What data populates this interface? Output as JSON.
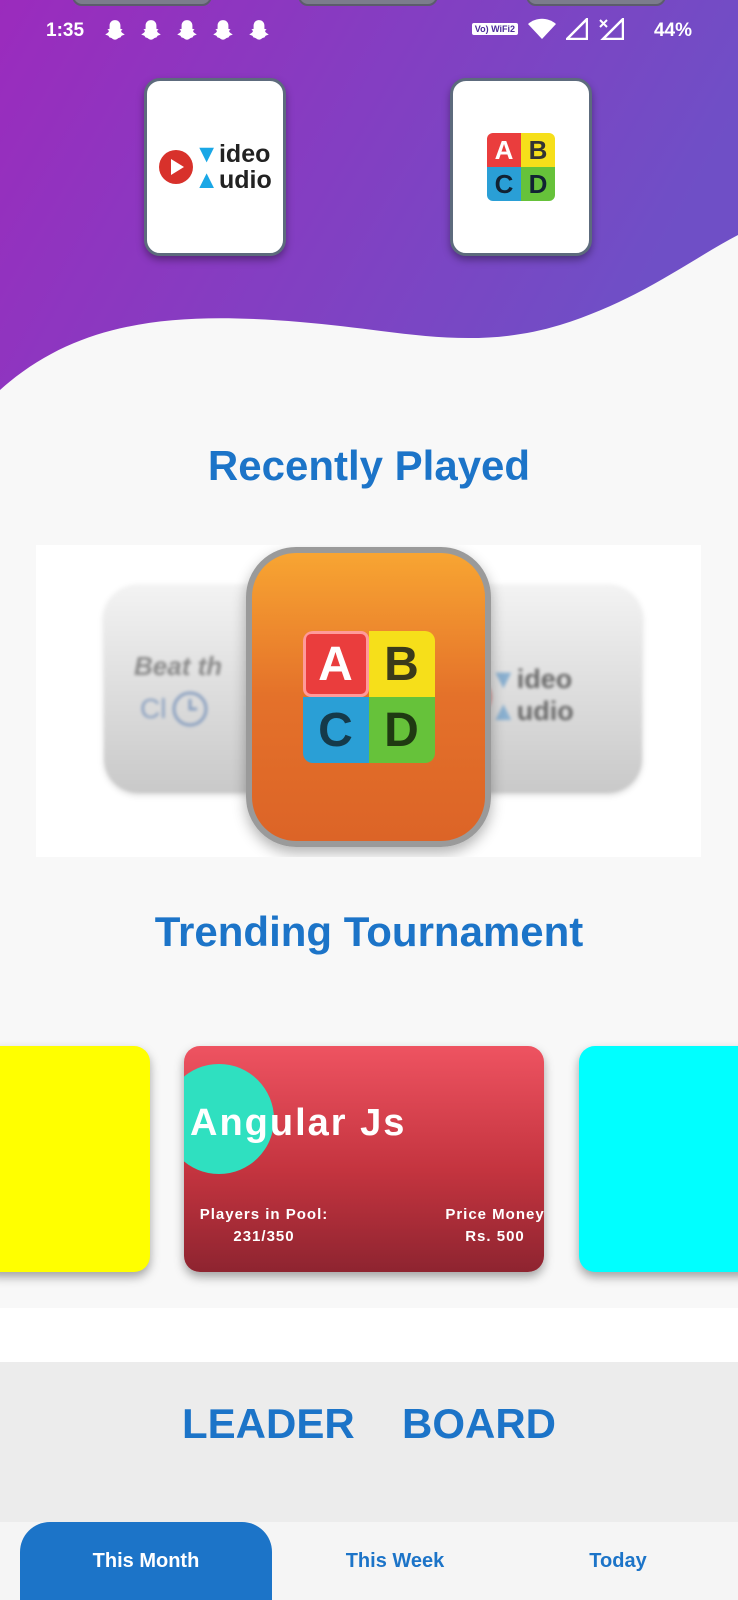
{
  "status_bar": {
    "time": "1:35",
    "network_label": "Vo) WiFi2",
    "battery": "44%"
  },
  "top_tiles": [
    {
      "name": "Video Audio",
      "line1": "ideo",
      "line2": "udio"
    },
    {
      "name": "ABCD",
      "letters": [
        "A",
        "B",
        "C",
        "D"
      ]
    }
  ],
  "recently_played": {
    "title": "Recently Played",
    "left_card": {
      "line1": "Beat th",
      "line2": "Cl"
    },
    "right_card": {
      "line1": "ideo",
      "line2": "udio"
    },
    "center_card": {
      "letters": [
        "A",
        "B",
        "C",
        "D"
      ]
    }
  },
  "trending": {
    "title": "Trending Tournament",
    "card": {
      "title": "Angular Js",
      "players_label": "Players in Pool:",
      "players_value": "231/350",
      "prize_label": "Price Money",
      "prize_value": "Rs. 500"
    }
  },
  "leaderboard": {
    "title": "LEADER  BOARD"
  },
  "tabs": [
    {
      "label": "This Month",
      "active": true
    },
    {
      "label": "This Week",
      "active": false
    },
    {
      "label": "Today",
      "active": false
    }
  ],
  "colors": {
    "accent": "#1c74c8",
    "header_start": "#9b2bbd",
    "header_end": "#6f4fc6"
  }
}
